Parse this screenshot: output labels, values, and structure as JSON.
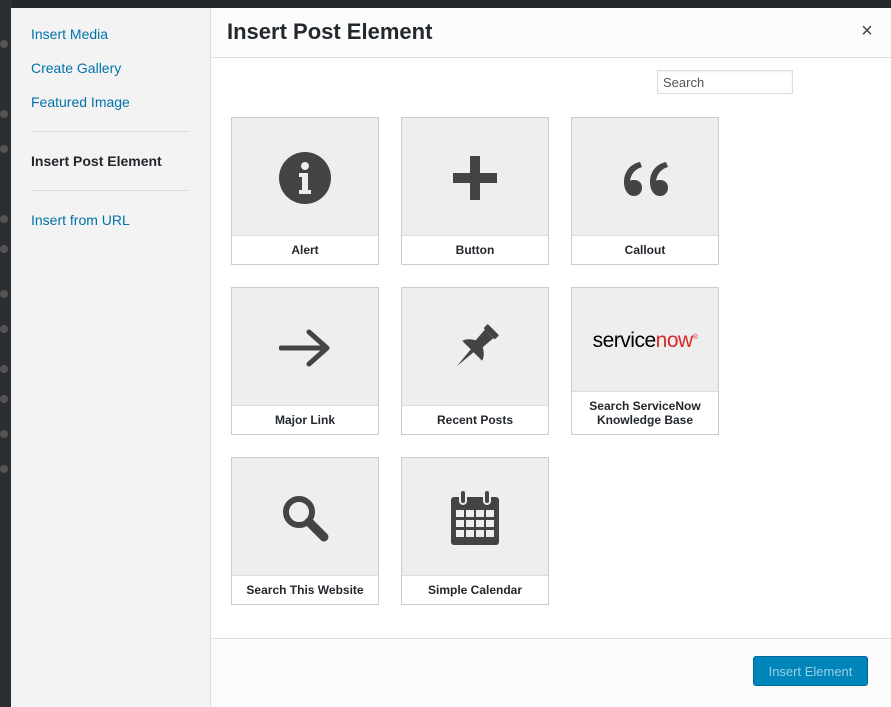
{
  "menu": {
    "items": [
      {
        "label": "Insert Media"
      },
      {
        "label": "Create Gallery"
      },
      {
        "label": "Featured Image"
      },
      {
        "label": "Insert Post Element"
      },
      {
        "label": "Insert from URL"
      }
    ],
    "active_index": 3
  },
  "header": {
    "title": "Insert Post Element",
    "close_glyph": "×"
  },
  "search": {
    "placeholder": "Search"
  },
  "elements": [
    {
      "label": "Alert",
      "icon": "info-icon"
    },
    {
      "label": "Button",
      "icon": "plus-icon"
    },
    {
      "label": "Callout",
      "icon": "quote-icon"
    },
    {
      "label": "Major Link",
      "icon": "arrow-right-icon"
    },
    {
      "label": "Recent Posts",
      "icon": "pushpin-icon"
    },
    {
      "label": "Search ServiceNow Knowledge Base",
      "icon": "servicenow-logo",
      "logo_text_a": "service",
      "logo_text_b": "now",
      "logo_reg": "®"
    },
    {
      "label": "Search This Website",
      "icon": "search-icon"
    },
    {
      "label": "Simple Calendar",
      "icon": "calendar-icon"
    }
  ],
  "footer": {
    "button_label": "Insert Element"
  },
  "colors": {
    "link": "#0073aa",
    "primary_button": "#0085ba",
    "icon": "#444444",
    "servicenow_red": "#d8282b"
  }
}
